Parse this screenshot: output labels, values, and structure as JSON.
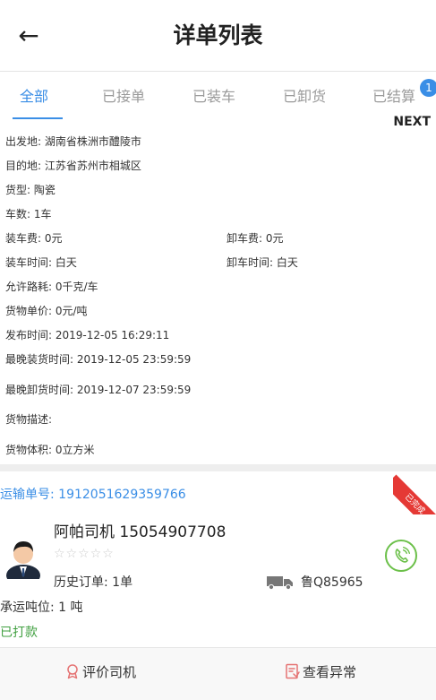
{
  "header": {
    "back_icon": "←",
    "title": "详单列表"
  },
  "tabs": {
    "items": [
      {
        "label": "全部",
        "active": true
      },
      {
        "label": "已接单",
        "active": false
      },
      {
        "label": "已装车",
        "active": false
      },
      {
        "label": "已卸货",
        "active": false
      },
      {
        "label": "已结算",
        "active": false
      }
    ],
    "badge": "1",
    "next": "NEXT"
  },
  "details": {
    "origin": "出发地: 湖南省株洲市醴陵市",
    "destination": "目的地: 江苏省苏州市相城区",
    "cargo_type": "货型: 陶瓷",
    "vehicle_count": "车数: 1车",
    "loading_fee": "装车费: 0元",
    "unloading_fee": "卸车费: 0元",
    "loading_time": "装车时间: 白天",
    "unloading_time": "卸车时间: 白天",
    "allowed_loss": "允许路耗: 0千克/车",
    "unit_price": "货物单价: 0元/吨",
    "publish_time": "发布时间: 2019-12-05 16:29:11",
    "latest_loading": "最晚装货时间: 2019-12-05 23:59:59",
    "latest_unloading": "最晚卸货时间: 2019-12-07 23:59:59",
    "description": "货物描述:",
    "volume": "货物体积: 0立方米"
  },
  "card": {
    "order_no": "运输单号: 1912051629359766",
    "ribbon": "已完成",
    "driver": "阿帕司机 15054907708",
    "stars": "☆☆☆☆☆",
    "history": "历史订单: 1单",
    "plate": "鲁Q85965",
    "capacity": "承运吨位: 1 吨",
    "payment_status": "已打款"
  },
  "actions": {
    "rate_driver": "评价司机",
    "view_exception": "查看异常"
  },
  "colors": {
    "accent": "#3a8ee6",
    "ribbon": "#e53935",
    "paid": "#3f9f3f",
    "phone": "#6cc04a"
  }
}
